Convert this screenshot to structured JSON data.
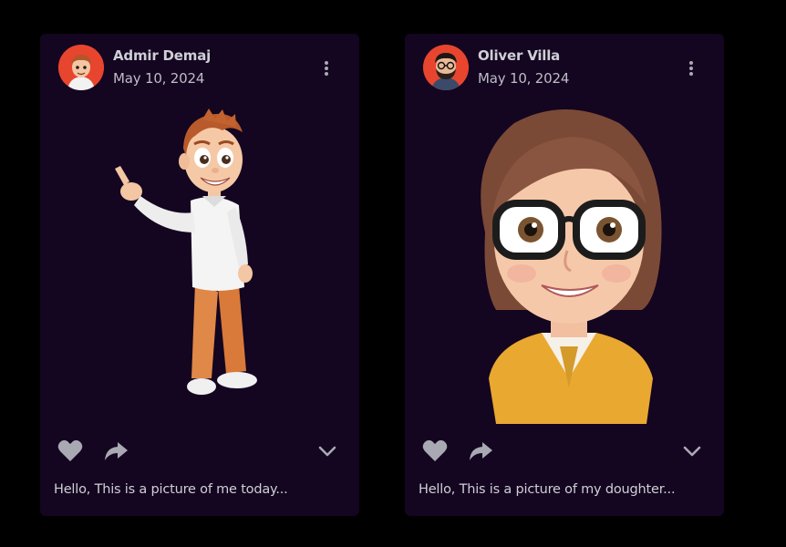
{
  "colors": {
    "page_background": "#000000",
    "card_background": "#140520",
    "text_primary": "#cfcfd6",
    "icon_color": "#a9a9b3",
    "avatar_background": "#e8452f"
  },
  "posts": [
    {
      "author": "Admir Demaj",
      "date": "May 10, 2024",
      "caption": "Hello, This is a picture of me today...",
      "avatar_icon": "avatar-boy-icon",
      "image": "3d-cartoon-boy-pointing"
    },
    {
      "author": "Oliver Villa",
      "date": "May 10, 2024",
      "caption": "Hello, This is a picture of my doughter...",
      "avatar_icon": "avatar-bearded-man-icon",
      "image": "3d-cartoon-girl-with-glasses"
    }
  ],
  "icons": {
    "more": "more-vertical-icon",
    "like": "heart-icon",
    "share": "share-arrow-icon",
    "expand": "chevron-down-icon"
  }
}
